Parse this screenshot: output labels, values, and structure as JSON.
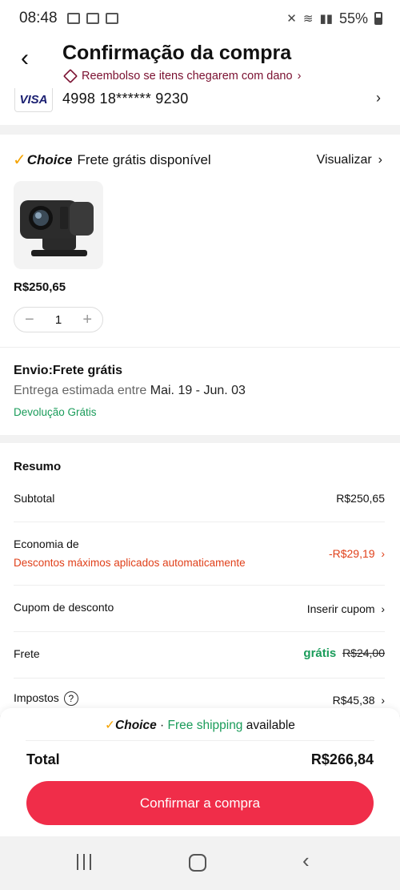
{
  "status": {
    "time": "08:48",
    "battery": "55%"
  },
  "header": {
    "title": "Confirmação da compra",
    "refund_note": "Reembolso se itens chegarem com dano",
    "refund_chevron": "›"
  },
  "payment": {
    "card_brand": "VISA",
    "card_number": "4998 18****** 9230",
    "chevron": "›"
  },
  "items": {
    "choice_check": "✓",
    "choice_logo": "Choice",
    "choice_text": "Frete grátis disponível",
    "view_label": "Visualizar",
    "view_chevron": "›",
    "price": "R$250,65",
    "quantity": "1",
    "minus": "−",
    "plus": "+"
  },
  "shipping": {
    "title": "Envio:Frete grátis",
    "estimate_prefix": "Entrega estimada entre ",
    "estimate_dates": "Mai. 19 - Jun. 03",
    "return_note": "Devolução Grátis"
  },
  "summary": {
    "title": "Resumo",
    "subtotal_label": "Subtotal",
    "subtotal_value": "R$250,65",
    "economy_label": "Economia de",
    "economy_sub": "Descontos máximos aplicados automaticamente",
    "economy_value": "-R$29,19",
    "coupon_label": "Cupom de desconto",
    "coupon_value": "Inserir cupom",
    "shipping_label": "Frete",
    "shipping_free": "grátis",
    "shipping_original": "R$24,00",
    "taxes_label": "Impostos",
    "taxes_help": "?",
    "taxes_value": "R$45,38",
    "chevron": "›"
  },
  "footer": {
    "banner_check": "✓",
    "banner_choice": "Choice",
    "banner_dot": " · ",
    "banner_free": "Free shipping",
    "banner_available": " available",
    "total_label": "Total",
    "total_value": "R$266,84",
    "confirm_label": "Confirmar a compra"
  },
  "nav": {
    "back_glyph": "‹"
  },
  "colors": {
    "accent": "#f02d49",
    "green": "#1a9c5a",
    "discount_red": "#e0401a",
    "choice_check": "#f5a300"
  }
}
